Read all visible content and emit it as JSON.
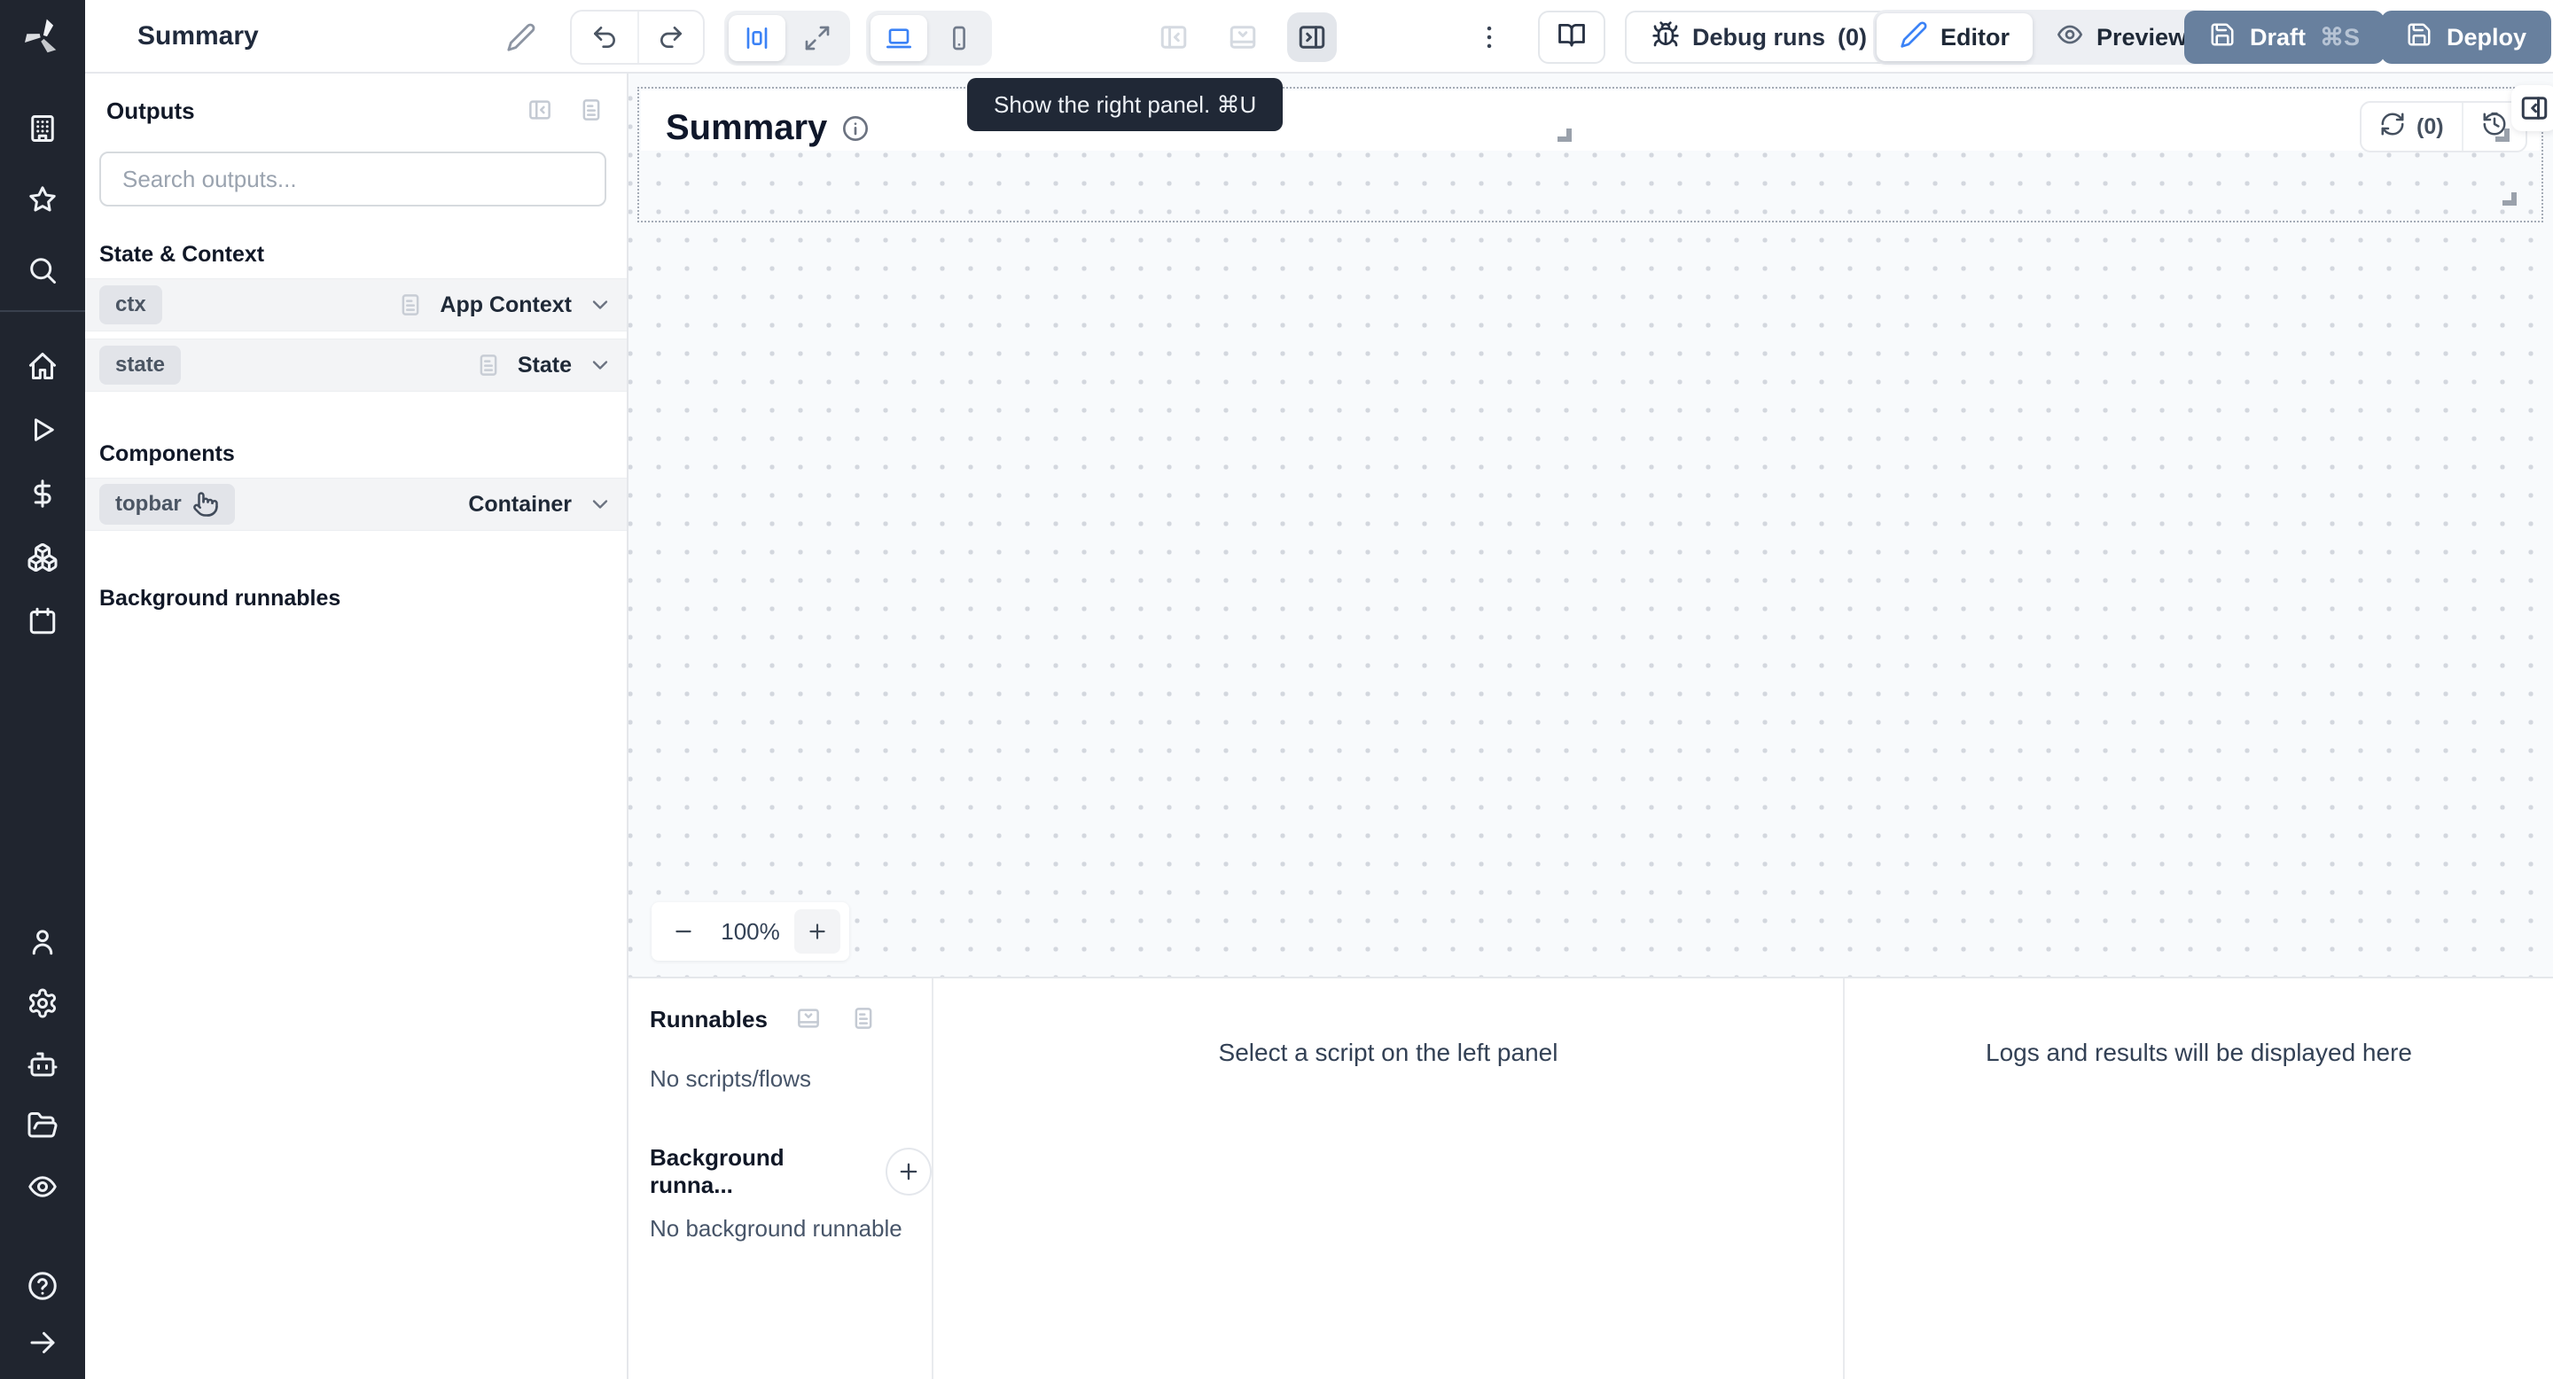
{
  "colors": {
    "accent_blue": "#3b82f6",
    "primary_button": "#68809e",
    "rail_background": "#20252f",
    "tooltip_background": "#202836",
    "canvas_background": "#f8fafc",
    "row_background": "#f3f4f6",
    "badge_background": "#e2e4e9"
  },
  "rail": {
    "logo_icon": "windmill-logo",
    "top_icons": [
      "building-icon",
      "star-icon",
      "search-icon"
    ],
    "mid_icons": [
      "home-icon",
      "play-icon",
      "dollar-icon",
      "cubes-icon",
      "calendar-icon"
    ],
    "account_icons": [
      "user-icon",
      "gear-icon",
      "robot-icon",
      "folder-open-icon",
      "eye-icon"
    ],
    "bottom_icons": [
      "help-icon",
      "arrow-right-icon"
    ]
  },
  "toolbar": {
    "title": "Summary",
    "edit_icon": "pencil-icon",
    "undo_icon": "undo-icon",
    "redo_icon": "redo-icon",
    "layout_icons": [
      "centered-layout-icon",
      "fullscreen-icon"
    ],
    "device_icons": [
      "laptop-icon",
      "smartphone-icon"
    ],
    "panel_toggle_icons": [
      "panel-left-icon",
      "panel-bottom-icon",
      "panel-right-icon"
    ],
    "menu_icon": "kebab-icon",
    "docs_icon": "book-icon",
    "debug_runs_label": "Debug runs",
    "debug_runs_count": "(0)",
    "editor_label": "Editor",
    "preview_label": "Preview",
    "draft_label": "Draft",
    "draft_shortcut": "⌘S",
    "deploy_label": "Deploy"
  },
  "outputs": {
    "title": "Outputs",
    "collapse_icon": "panel-left-collapse-icon",
    "doc_icon": "doc-lines-icon",
    "search_placeholder": "Search outputs...",
    "section_state_context": "State & Context",
    "section_components": "Components",
    "section_background": "Background runnables",
    "rows": {
      "ctx": {
        "badge": "ctx",
        "type": "App Context"
      },
      "state": {
        "badge": "state",
        "type": "State"
      },
      "topbar": {
        "badge": "topbar",
        "type": "Container",
        "cursor_icon": "hand-pointer-icon"
      }
    }
  },
  "canvas": {
    "heading": "Summary",
    "info_icon": "info-icon",
    "tooltip": "Show the right panel. ⌘U",
    "refresh_icon": "refresh-icon",
    "refresh_count": "(0)",
    "history_icon": "history-icon",
    "corner_icon": "panel-right-collapse-icon",
    "zoom": {
      "minus": "−",
      "level": "100%",
      "plus": "+"
    }
  },
  "bottom": {
    "runnables_title": "Runnables",
    "collapse_icon": "panel-bottom-collapse-icon",
    "doc_icon": "doc-lines-icon",
    "empty_scripts": "No scripts/flows",
    "background_title": "Background runna...",
    "add_icon": "plus-icon",
    "empty_background": "No background runnable",
    "script_placeholder": "Select a script on the left panel",
    "logs_placeholder": "Logs and results will be displayed here"
  }
}
